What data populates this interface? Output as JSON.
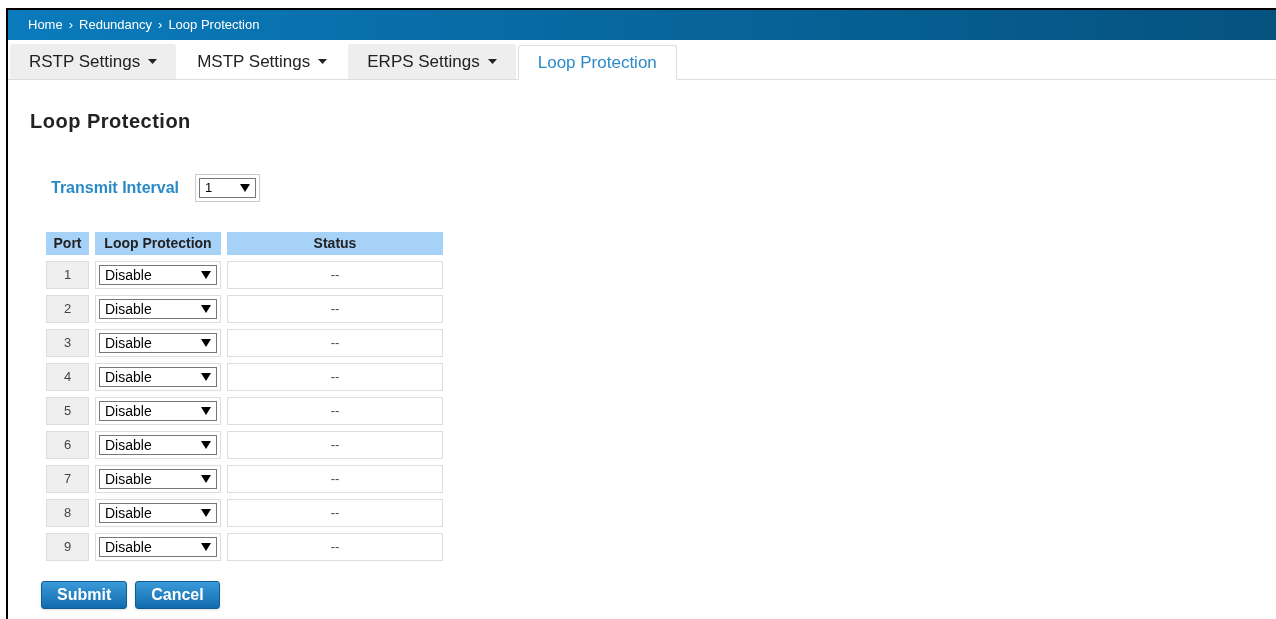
{
  "breadcrumb": [
    {
      "label": "Home"
    },
    {
      "label": "Redundancy"
    },
    {
      "label": "Loop Protection"
    }
  ],
  "breadcrumb_separator": "›",
  "tabs": [
    {
      "label": "RSTP Settings",
      "dropdown": true,
      "selected": false
    },
    {
      "label": "MSTP Settings",
      "dropdown": true,
      "selected": false
    },
    {
      "label": "ERPS Settings",
      "dropdown": true,
      "selected": false
    },
    {
      "label": "Loop Protection",
      "dropdown": false,
      "selected": true
    }
  ],
  "page_title": "Loop Protection",
  "transmit_interval": {
    "label": "Transmit Interval",
    "value": "1"
  },
  "table": {
    "columns": [
      "Port",
      "Loop Protection",
      "Status"
    ],
    "rows": [
      {
        "port": "1",
        "loop_protection": "Disable",
        "status": "--"
      },
      {
        "port": "2",
        "loop_protection": "Disable",
        "status": "--"
      },
      {
        "port": "3",
        "loop_protection": "Disable",
        "status": "--"
      },
      {
        "port": "4",
        "loop_protection": "Disable",
        "status": "--"
      },
      {
        "port": "5",
        "loop_protection": "Disable",
        "status": "--"
      },
      {
        "port": "6",
        "loop_protection": "Disable",
        "status": "--"
      },
      {
        "port": "7",
        "loop_protection": "Disable",
        "status": "--"
      },
      {
        "port": "8",
        "loop_protection": "Disable",
        "status": "--"
      },
      {
        "port": "9",
        "loop_protection": "Disable",
        "status": "--"
      }
    ]
  },
  "buttons": [
    "Submit",
    "Cancel"
  ]
}
